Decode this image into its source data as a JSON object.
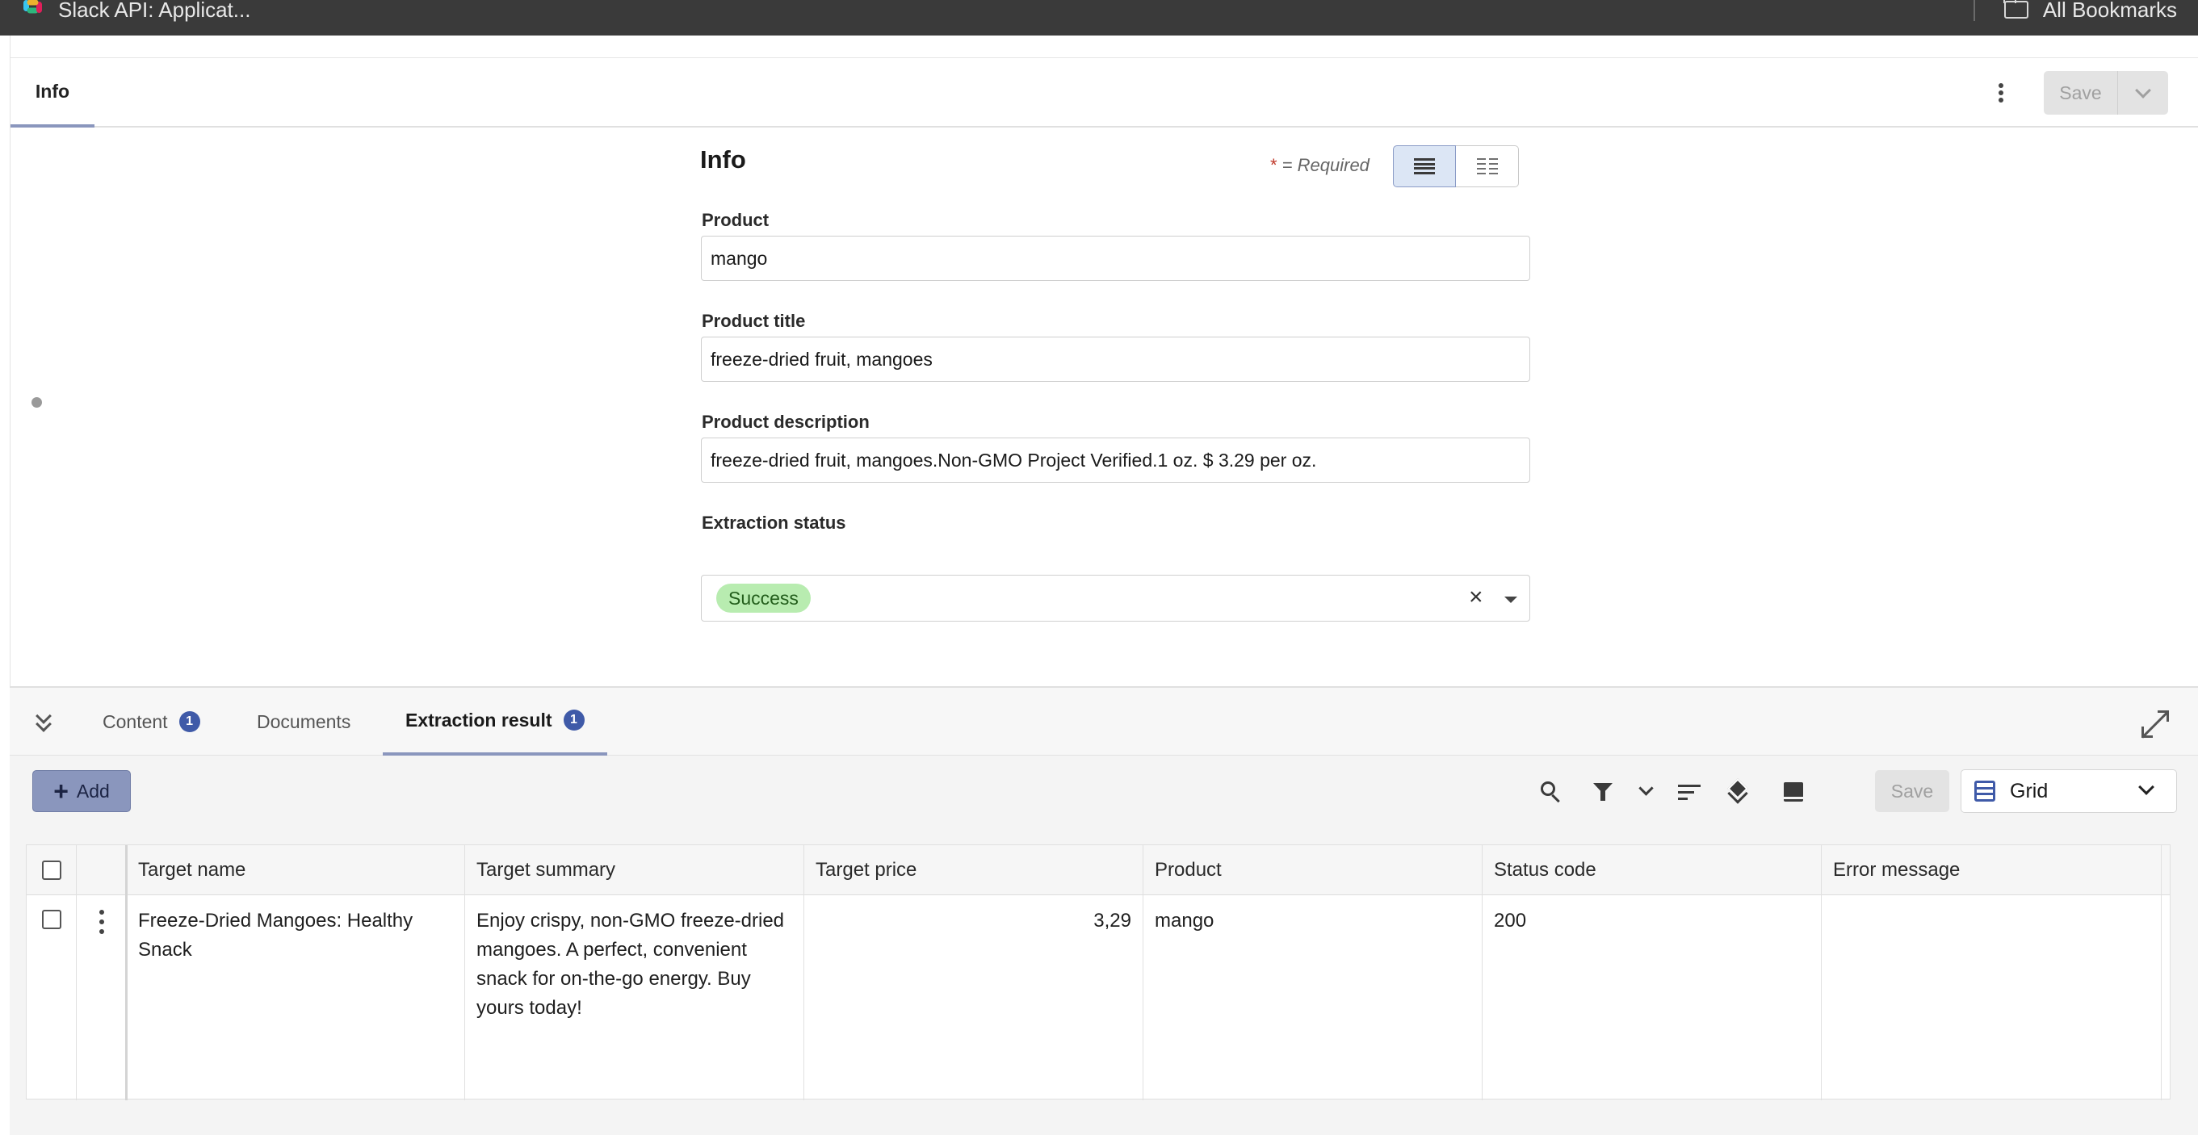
{
  "browser": {
    "bookmark_left": "Slack API: Applicat...",
    "bookmark_right": "All Bookmarks"
  },
  "top_tabs": {
    "info": "Info"
  },
  "header_save": "Save",
  "form": {
    "title": "Info",
    "required_star": "*",
    "required_text": " = Required",
    "fields": {
      "product": {
        "label": "Product",
        "value": "mango"
      },
      "product_title": {
        "label": "Product title",
        "value": "freeze-dried fruit, mangoes"
      },
      "product_description": {
        "label": "Product description",
        "value": "freeze-dried fruit, mangoes.Non-GMO Project Verified.1 oz. $ 3.29 per oz."
      },
      "extraction_status": {
        "label": "Extraction status",
        "value": "Success",
        "clear": "×"
      }
    }
  },
  "bottom_tabs": [
    {
      "label": "Content",
      "count": "1"
    },
    {
      "label": "Documents"
    },
    {
      "label": "Extraction result",
      "count": "1"
    }
  ],
  "toolbar": {
    "add_label": "Add",
    "save_label": "Save",
    "view_select": "Grid"
  },
  "grid": {
    "columns": [
      "Target name",
      "Target summary",
      "Target price",
      "Product",
      "Status code",
      "Error message"
    ],
    "rows": [
      {
        "target_name": "Freeze-Dried Mangoes: Healthy Snack",
        "target_summary": "Enjoy crispy, non-GMO freeze-dried mangoes. A perfect, convenient snack for on-the-go energy. Buy yours today!",
        "target_price": "3,29",
        "product": "mango",
        "status_code": "200",
        "error_message": ""
      }
    ]
  },
  "colors": {
    "accent": "#8a96bd",
    "badge": "#3f5aa8",
    "success_chip": "#b8ecb0",
    "browser_bar": "#3a3a3a"
  }
}
